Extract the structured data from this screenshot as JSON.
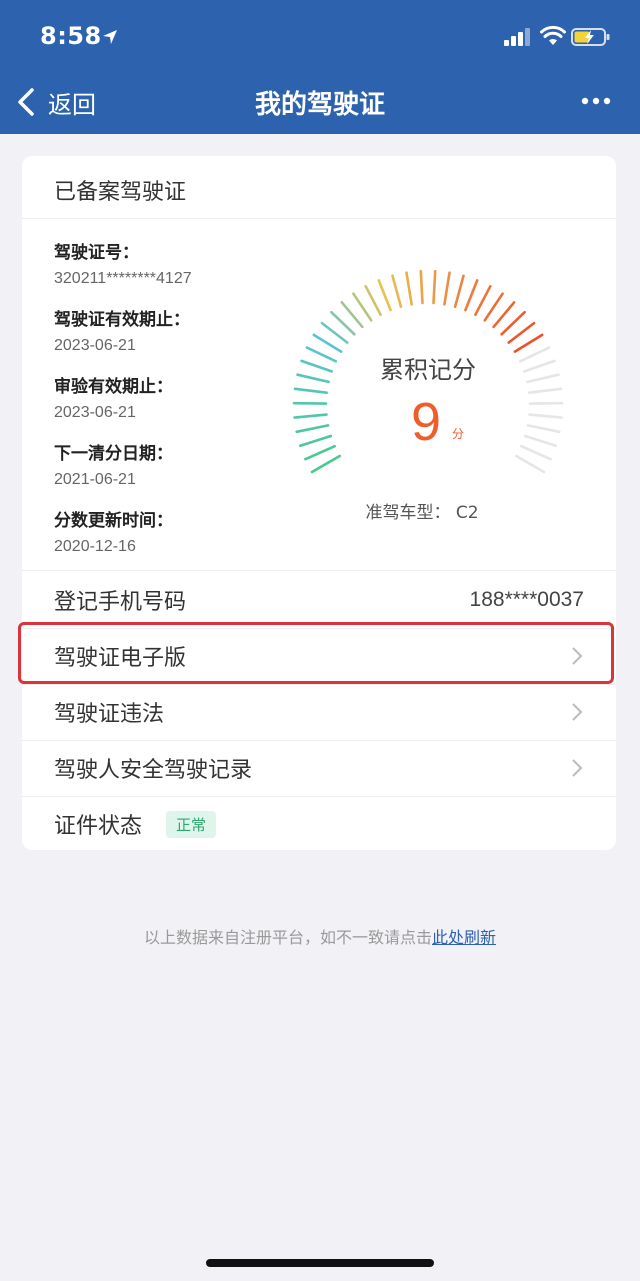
{
  "status_bar": {
    "time": "8:58"
  },
  "nav": {
    "back_label": "返回",
    "title": "我的驾驶证"
  },
  "card": {
    "title": "已备案驾驶证",
    "info": [
      {
        "label": "驾驶证号：",
        "value": "320211********4127"
      },
      {
        "label": "驾驶证有效期止：",
        "value": "2023-06-21"
      },
      {
        "label": "审验有效期止：",
        "value": "2023-06-21"
      },
      {
        "label": "下一清分日期：",
        "value": "2021-06-21"
      },
      {
        "label": "分数更新时间：",
        "value": "2020-12-16"
      }
    ],
    "gauge": {
      "title": "累积记分",
      "score": "9",
      "unit": "分",
      "vehicle_label": "准驾车型：",
      "vehicle_value": "C2",
      "max_points": 12,
      "points": 9
    },
    "phone": {
      "label": "登记手机号码",
      "value": "188****0037"
    },
    "menu": [
      {
        "label": "驾驶证电子版"
      },
      {
        "label": "驾驶证违法"
      },
      {
        "label": "驾驶人安全驾驶记录"
      }
    ],
    "status": {
      "label": "证件状态",
      "badge": "正常"
    }
  },
  "footer": {
    "note": "以上数据来自注册平台，如不一致请点击",
    "link": "此处刷新"
  },
  "colors": {
    "header": "#2d62ae",
    "score": "#ef5d2b",
    "highlight": "#d9353d",
    "badge_bg": "#dff4ea",
    "badge_text": "#2da771"
  }
}
